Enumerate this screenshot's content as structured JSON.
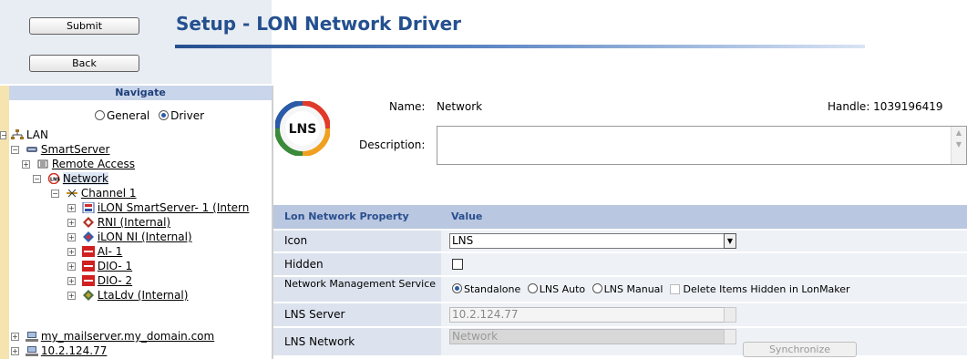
{
  "toolbar": {
    "submit_label": "Submit",
    "back_label": "Back"
  },
  "page": {
    "title": "Setup - LON Network Driver"
  },
  "nav": {
    "header": "Navigate",
    "radio_general": "General",
    "radio_driver": "Driver",
    "radio_selected": "Driver",
    "tree": {
      "lan": "LAN",
      "smartserver": "SmartServer",
      "remote_access": "Remote Access",
      "network": "Network",
      "channel": "Channel 1",
      "ilon_smartserver": "iLON SmartServer- 1 (Intern",
      "rni": "RNI (Internal)",
      "ilon_ni": "iLON NI (Internal)",
      "ai1": "AI- 1",
      "dio1": "DIO- 1",
      "dio2": "DIO- 2",
      "ltaldv": "LtaLdv (Internal)",
      "mailserver": "my_mailserver.my_domain.com",
      "ip": "10.2.124.77"
    }
  },
  "details": {
    "logo_text": "LNS",
    "name_label": "Name:",
    "name_value": "Network",
    "handle_text": "Handle: 1039196419",
    "description_label": "Description:",
    "description_value": ""
  },
  "properties": {
    "col_property": "Lon Network Property",
    "col_value": "Value",
    "icon_label": "Icon",
    "icon_value": "LNS",
    "hidden_label": "Hidden",
    "hidden_checked": false,
    "nms_label": "Network Management Service",
    "nms_options": {
      "standalone": "Standalone",
      "lns_auto": "LNS Auto",
      "lns_manual": "LNS Manual"
    },
    "nms_selected": "Standalone",
    "delete_hidden_label": "Delete Items Hidden in LonMaker",
    "lns_server_label": "LNS Server",
    "lns_server_value": "10.2.124.77",
    "lns_network_label": "LNS Network",
    "lns_network_value": "Network",
    "sync_label": "Synchronize"
  },
  "colors": {
    "title": "#24508f",
    "grid_header": "#b9c7e0",
    "grid_key": "#dde3ee",
    "grid_value": "#eef1f6",
    "nav_strip": "#f5e4b0"
  }
}
